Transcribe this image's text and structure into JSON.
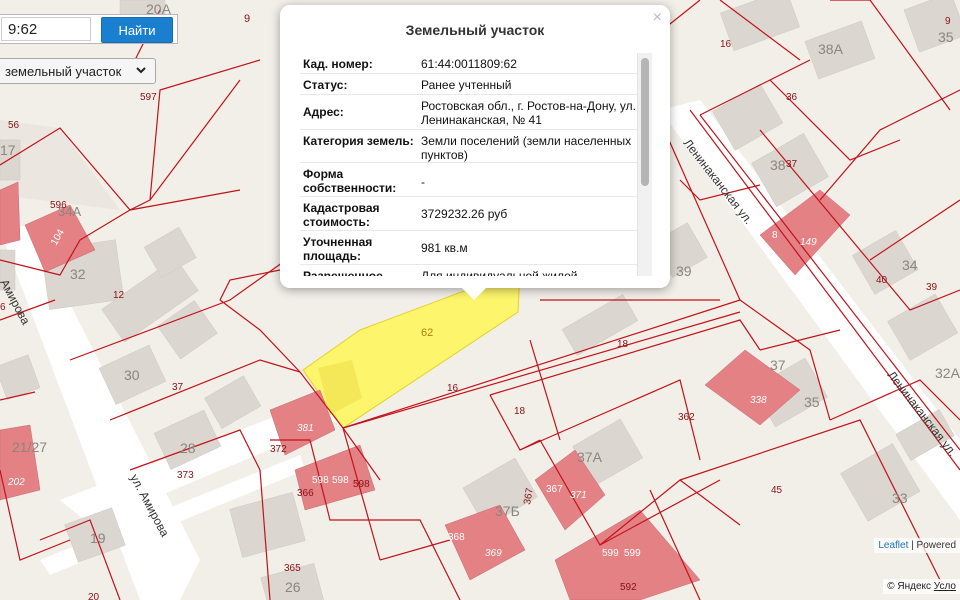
{
  "search": {
    "value": "9:62",
    "button_label": "Найти"
  },
  "layer_select": {
    "selected": "земельный участок"
  },
  "popup": {
    "title": "Земельный участок",
    "close_label": "×",
    "rows": [
      {
        "key": "Кад. номер:",
        "value": "61:44:0011809:62"
      },
      {
        "key": "Статус:",
        "value": "Ранее учтенный"
      },
      {
        "key": "Адрес:",
        "value": "Ростовская обл., г. Ростов-на-Дону, ул. Ленинаканская, № 41"
      },
      {
        "key": "Категория земель:",
        "value": "Земли поселений (земли населенных пунктов)"
      },
      {
        "key": "Форма собственности:",
        "value": "-"
      },
      {
        "key": "Кадастровая стоимость:",
        "value": "3729232.26 руб"
      },
      {
        "key": "Уточненная площадь:",
        "value": "981 кв.м"
      },
      {
        "key": "Разрешенное",
        "value": "Для индивидуальной жилой"
      }
    ]
  },
  "map": {
    "colors": {
      "background": "#f2efe9",
      "building": "#dbd6cf",
      "road": "#ffffff",
      "boundary": "#c2121a",
      "highlight": "#fdf56b",
      "parcel_building": "#e38185"
    },
    "streets": {
      "leninakanskaya_1": "Ленинаканская ул.",
      "leninakanskaya_2": "Ленинаканская ул.",
      "amirova": "ул. Амирова",
      "amirova_left": "Амирова"
    },
    "house_numbers": {
      "n32": "32",
      "n34a": "34А",
      "n30": "30",
      "n28": "28",
      "n21_27": "21/27",
      "n19": "19",
      "n26": "26",
      "n9": "9",
      "n20a": "20А",
      "n35": "35",
      "n38a": "38А",
      "n36": "36",
      "n38": "38",
      "n34": "34",
      "n32a": "32А",
      "n37": "37",
      "n35b": "35",
      "n33": "33",
      "n39": "39",
      "n37a": "37А",
      "n37b": "37Б",
      "n17": "17"
    },
    "parcel_numbers": {
      "p62": "62",
      "p597": "597",
      "p56": "56",
      "p596": "596",
      "p104": "104",
      "p12": "12",
      "p37": "37",
      "p373": "373",
      "p372": "372",
      "p381": "381",
      "p366": "366",
      "p598a": "598",
      "p598b": "598",
      "p598c": "598",
      "p16": "16",
      "p18a": "18",
      "p18b": "18",
      "p362": "362",
      "p338": "338",
      "p45": "45",
      "p367a": "367",
      "p367b": "367",
      "p371": "371",
      "p368": "368",
      "p369": "369",
      "p599a": "599",
      "p599b": "599",
      "p592": "592",
      "p365": "365",
      "p20": "20",
      "p202": "202",
      "p16b": "16",
      "p36": "36",
      "p37b": "37",
      "p8": "8",
      "p149": "149",
      "p40": "40",
      "p39": "39",
      "p9": "9",
      "p6": "6"
    }
  },
  "attribution": {
    "leaflet": "Leaflet",
    "powered": "| Powered",
    "yandex": "© Яндекс",
    "terms": "Усло"
  }
}
